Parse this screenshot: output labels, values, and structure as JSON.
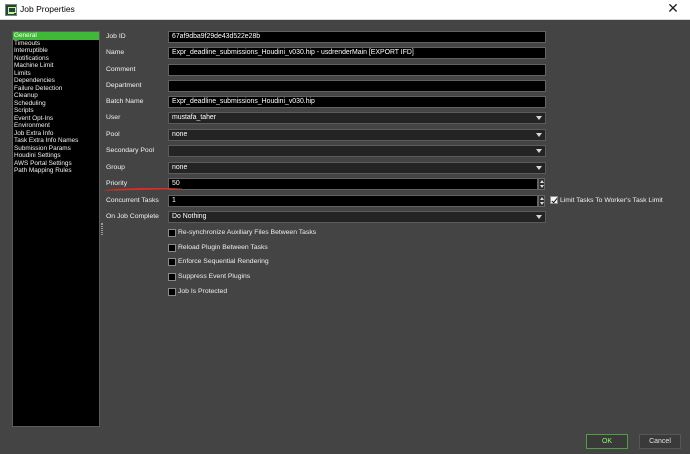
{
  "window": {
    "title": "Job Properties",
    "icon": "deadline-monitor-icon",
    "close_glyph": "✕"
  },
  "sidebar": {
    "items": [
      {
        "label": "General",
        "active": true
      },
      {
        "label": "Timeouts",
        "active": false
      },
      {
        "label": "Interruptible",
        "active": false
      },
      {
        "label": "Notifications",
        "active": false
      },
      {
        "label": "Machine Limit",
        "active": false
      },
      {
        "label": "Limits",
        "active": false
      },
      {
        "label": "Dependencies",
        "active": false
      },
      {
        "label": "Failure Detection",
        "active": false
      },
      {
        "label": "Cleanup",
        "active": false
      },
      {
        "label": "Scheduling",
        "active": false
      },
      {
        "label": "Scripts",
        "active": false
      },
      {
        "label": "Event Opt-Ins",
        "active": false
      },
      {
        "label": "Environment",
        "active": false
      },
      {
        "label": "Job Extra Info",
        "active": false
      },
      {
        "label": "Task Extra Info Names",
        "active": false
      },
      {
        "label": "Submission Params",
        "active": false
      },
      {
        "label": "Houdini Settings",
        "active": false
      },
      {
        "label": "AWS Portal Settings",
        "active": false
      },
      {
        "label": "Path Mapping Rules",
        "active": false
      }
    ]
  },
  "form": {
    "job_id": {
      "label": "Job ID",
      "value": "67af9dba9f29de43d522e28b"
    },
    "name": {
      "label": "Name",
      "value": "Expr_deadline_submissions_Houdini_v030.hip - usdrenderMain [EXPORT IFD]"
    },
    "comment": {
      "label": "Comment",
      "value": ""
    },
    "department": {
      "label": "Department",
      "value": ""
    },
    "batch_name": {
      "label": "Batch Name",
      "value": "Expr_deadline_submissions_Houdini_v030.hip"
    },
    "user": {
      "label": "User",
      "value": "mustafa_taher"
    },
    "pool": {
      "label": "Pool",
      "value": "none"
    },
    "secondary_pool": {
      "label": "Secondary Pool",
      "value": ""
    },
    "group": {
      "label": "Group",
      "value": "none"
    },
    "priority": {
      "label": "Priority",
      "value": "50"
    },
    "concurrent_tasks": {
      "label": "Concurrent Tasks",
      "value": "1"
    },
    "limit_tasks_label": "Limit Tasks To Worker's Task Limit",
    "on_job_complete": {
      "label": "On Job Complete",
      "value": "Do Nothing"
    }
  },
  "options": [
    {
      "label": "Re-synchronize Auxiliary Files Between Tasks",
      "checked": false
    },
    {
      "label": "Reload Plugin Between Tasks",
      "checked": false
    },
    {
      "label": "Enforce Sequential Rendering",
      "checked": false
    },
    {
      "label": "Suppress Event Plugins",
      "checked": false
    },
    {
      "label": "Job Is Protected",
      "checked": false
    }
  ],
  "buttons": {
    "ok": "OK",
    "cancel": "Cancel"
  },
  "colors": {
    "window_bg": "#444444",
    "sidebar_bg": "#000000",
    "active_item": "#3fba38",
    "field_bg": "#000000",
    "select_bg": "#242424",
    "highlight": "#e02a24",
    "ok_text": "#8aff62"
  }
}
